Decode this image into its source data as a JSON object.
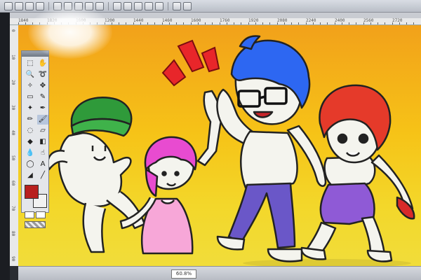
{
  "toolbar": {
    "icons": [
      "new-file-icon",
      "open-icon",
      "save-icon",
      "print-icon",
      "cut-icon",
      "copy-icon",
      "paste-icon",
      "undo-icon",
      "redo-icon",
      "layer-icon",
      "select-icon",
      "brush-icon",
      "eraser-icon",
      "fill-icon",
      "ruler-icon",
      "help-icon"
    ]
  },
  "ruler": {
    "h_ticks": [
      "1840",
      "1820",
      "1600",
      "1200",
      "1440",
      "1460",
      "1600",
      "1760",
      "1920",
      "2080",
      "2240",
      "2400",
      "2560",
      "2720"
    ],
    "v_ticks": [
      "0",
      "10",
      "20",
      "30",
      "40",
      "50",
      "60",
      "70",
      "80",
      "90"
    ]
  },
  "tools": [
    {
      "icon": "marquee-icon",
      "glyph": "⬚"
    },
    {
      "icon": "hand-icon",
      "glyph": "✋"
    },
    {
      "icon": "zoom-icon",
      "glyph": "🔍"
    },
    {
      "icon": "lasso-icon",
      "glyph": "➰"
    },
    {
      "icon": "magic-wand-icon",
      "glyph": "✧"
    },
    {
      "icon": "move-icon",
      "glyph": "✥"
    },
    {
      "icon": "rect-select-icon",
      "glyph": "▭"
    },
    {
      "icon": "eyedropper-icon",
      "glyph": "✎"
    },
    {
      "icon": "wand-icon",
      "glyph": "✦"
    },
    {
      "icon": "pen-icon",
      "glyph": "✒"
    },
    {
      "icon": "pencil-icon",
      "glyph": "✏"
    },
    {
      "icon": "brush-icon",
      "glyph": "🖌"
    },
    {
      "icon": "airbrush-icon",
      "glyph": "◌"
    },
    {
      "icon": "eraser-icon",
      "glyph": "▱"
    },
    {
      "icon": "fill-icon",
      "glyph": "◆"
    },
    {
      "icon": "gradient-icon",
      "glyph": "◧"
    },
    {
      "icon": "blur-icon",
      "glyph": "💧"
    },
    {
      "icon": "smudge-icon",
      "glyph": "☝"
    },
    {
      "icon": "dodge-icon",
      "glyph": "◯"
    },
    {
      "icon": "text-icon",
      "glyph": "A"
    },
    {
      "icon": "shape-icon",
      "glyph": "◢"
    },
    {
      "icon": "line-icon",
      "glyph": "╱"
    }
  ],
  "colors": {
    "foreground": "#b8201f",
    "background": "#f2f2f2",
    "canvas_top": "#f2a11a",
    "canvas_bottom": "#f1dd3a"
  },
  "status": {
    "zoom": "60.8%"
  }
}
